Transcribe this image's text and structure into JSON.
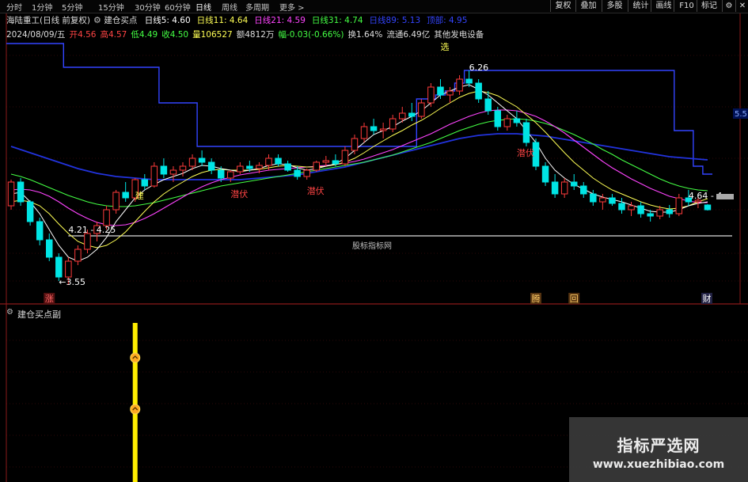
{
  "toolbar": {
    "periods": [
      "分时",
      "1分钟",
      "5分钟",
      "15分钟",
      "30分钟",
      "60分钟",
      "日线",
      "周线",
      "多周期",
      "更多 >"
    ],
    "active_period": "日线",
    "buttons": [
      "复权",
      "叠加",
      "多股",
      "统计",
      "画线",
      "F10",
      "标记"
    ]
  },
  "header": {
    "stock": "海陆重工(日线 前复权)",
    "indicator": "建仓买点",
    "ma": [
      {
        "label": "日线5:",
        "value": "4.60",
        "color": "#ffffff"
      },
      {
        "label": "日线11:",
        "value": "4.64",
        "color": "#ffff55"
      },
      {
        "label": "日线21:",
        "value": "4.59",
        "color": "#ff44ff"
      },
      {
        "label": "日线31:",
        "value": "4.74",
        "color": "#44ff44"
      },
      {
        "label": "日线89:",
        "value": "5.13",
        "color": "#3344ff"
      },
      {
        "label": "顶部:",
        "value": "4.95",
        "color": "#3344ff"
      }
    ],
    "date": "2024/08/09/五",
    "open_label": "开",
    "open": "4.56",
    "high_label": "高",
    "high": "4.57",
    "low_label": "低",
    "low": "4.49",
    "close_label": "收",
    "close": "4.50",
    "volume_label": "量",
    "volume": "106527",
    "amount_label": "额",
    "amount": "4812万",
    "change_label": "幅",
    "change": "-0.03(-0.66%)",
    "turnover_label": "换",
    "turnover": "1.64%",
    "float_label": "流通",
    "float": "6.49亿",
    "sector": "其他发电设备"
  },
  "indicator_panel": {
    "label": "建仓买点副"
  },
  "watermark": {
    "title": "指标严选网",
    "url": "www.xuezhibiao.com"
  },
  "colors": {
    "up": "#ff3b3b",
    "down": "#00e5e5",
    "ma5": "#ffffff",
    "ma11": "#ffff55",
    "ma21": "#ff44ff",
    "ma31": "#44ff44",
    "ma89": "#2233dd",
    "top": "#3344ff",
    "signal": "#ffee00"
  },
  "chart_data": {
    "type": "candlestick",
    "ylim": [
      3.4,
      6.6
    ],
    "y_side_label": "5.5",
    "candles": [
      [
        4.55,
        4.88,
        4.5,
        4.85
      ],
      [
        4.85,
        4.9,
        4.55,
        4.6
      ],
      [
        4.6,
        4.62,
        4.3,
        4.35
      ],
      [
        4.35,
        4.4,
        4.05,
        4.12
      ],
      [
        4.12,
        4.2,
        3.85,
        3.9
      ],
      [
        3.9,
        3.95,
        3.6,
        3.65
      ],
      [
        3.65,
        3.9,
        3.55,
        3.85
      ],
      [
        3.85,
        4.05,
        3.8,
        4.0
      ],
      [
        4.0,
        4.25,
        3.95,
        4.2
      ],
      [
        4.2,
        4.35,
        4.1,
        4.3
      ],
      [
        4.3,
        4.55,
        4.25,
        4.5
      ],
      [
        4.5,
        4.75,
        4.45,
        4.72
      ],
      [
        4.72,
        4.85,
        4.6,
        4.65
      ],
      [
        4.65,
        4.9,
        4.6,
        4.88
      ],
      [
        4.88,
        4.95,
        4.75,
        4.8
      ],
      [
        4.8,
        5.1,
        4.78,
        5.05
      ],
      [
        5.05,
        5.15,
        4.9,
        4.95
      ],
      [
        4.95,
        5.05,
        4.85,
        5.0
      ],
      [
        5.0,
        5.1,
        4.92,
        5.05
      ],
      [
        5.05,
        5.2,
        5.0,
        5.15
      ],
      [
        5.15,
        5.25,
        5.05,
        5.1
      ],
      [
        5.1,
        5.15,
        4.95,
        5.0
      ],
      [
        5.0,
        5.05,
        4.85,
        4.9
      ],
      [
        4.9,
        5.0,
        4.85,
        4.98
      ],
      [
        4.98,
        5.1,
        4.95,
        5.05
      ],
      [
        5.05,
        5.12,
        4.98,
        5.02
      ],
      [
        5.02,
        5.1,
        4.96,
        5.06
      ],
      [
        5.06,
        5.2,
        5.0,
        5.15
      ],
      [
        5.15,
        5.2,
        5.05,
        5.08
      ],
      [
        5.08,
        5.12,
        4.98,
        5.0
      ],
      [
        5.0,
        5.05,
        4.88,
        4.92
      ],
      [
        4.92,
        5.02,
        4.88,
        5.0
      ],
      [
        5.0,
        5.12,
        4.98,
        5.1
      ],
      [
        5.1,
        5.18,
        5.05,
        5.12
      ],
      [
        5.12,
        5.2,
        5.05,
        5.08
      ],
      [
        5.08,
        5.3,
        5.05,
        5.25
      ],
      [
        5.25,
        5.45,
        5.2,
        5.4
      ],
      [
        5.4,
        5.6,
        5.35,
        5.55
      ],
      [
        5.55,
        5.65,
        5.45,
        5.5
      ],
      [
        5.5,
        5.6,
        5.4,
        5.52
      ],
      [
        5.52,
        5.7,
        5.48,
        5.65
      ],
      [
        5.65,
        5.8,
        5.6,
        5.72
      ],
      [
        5.72,
        5.85,
        5.62,
        5.68
      ],
      [
        5.68,
        5.9,
        5.65,
        5.85
      ],
      [
        5.85,
        6.1,
        5.8,
        6.05
      ],
      [
        6.05,
        6.15,
        5.9,
        5.95
      ],
      [
        5.95,
        6.05,
        5.85,
        6.0
      ],
      [
        6.0,
        6.2,
        5.95,
        6.15
      ],
      [
        6.15,
        6.26,
        6.05,
        6.1
      ],
      [
        6.1,
        6.15,
        5.85,
        5.9
      ],
      [
        5.9,
        6.0,
        5.7,
        5.75
      ],
      [
        5.75,
        5.8,
        5.5,
        5.55
      ],
      [
        5.55,
        5.7,
        5.5,
        5.65
      ],
      [
        5.65,
        5.75,
        5.55,
        5.6
      ],
      [
        5.6,
        5.65,
        5.3,
        5.35
      ],
      [
        5.35,
        5.4,
        5.0,
        5.05
      ],
      [
        5.05,
        5.1,
        4.8,
        4.85
      ],
      [
        4.85,
        4.95,
        4.65,
        4.7
      ],
      [
        4.7,
        4.9,
        4.65,
        4.85
      ],
      [
        4.85,
        4.95,
        4.75,
        4.8
      ],
      [
        4.8,
        4.85,
        4.65,
        4.7
      ],
      [
        4.7,
        4.75,
        4.55,
        4.6
      ],
      [
        4.6,
        4.7,
        4.5,
        4.65
      ],
      [
        4.65,
        4.7,
        4.55,
        4.58
      ],
      [
        4.58,
        4.65,
        4.45,
        4.5
      ],
      [
        4.5,
        4.6,
        4.42,
        4.55
      ],
      [
        4.55,
        4.6,
        4.4,
        4.45
      ],
      [
        4.45,
        4.5,
        4.35,
        4.42
      ],
      [
        4.42,
        4.55,
        4.38,
        4.5
      ],
      [
        4.5,
        4.56,
        4.4,
        4.45
      ],
      [
        4.45,
        4.7,
        4.42,
        4.65
      ],
      [
        4.65,
        4.75,
        4.55,
        4.6
      ],
      [
        4.6,
        4.66,
        4.52,
        4.62
      ],
      [
        4.56,
        4.57,
        4.49,
        4.5
      ]
    ],
    "ma5": [
      4.7,
      4.72,
      4.6,
      4.45,
      4.25,
      4.05,
      3.9,
      3.85,
      3.9,
      4.0,
      4.15,
      4.35,
      4.5,
      4.65,
      4.75,
      4.82,
      4.88,
      4.92,
      4.96,
      5.02,
      5.06,
      5.05,
      5.02,
      5.0,
      4.98,
      5.0,
      5.02,
      5.06,
      5.08,
      5.07,
      5.03,
      5.0,
      5.02,
      5.05,
      5.08,
      5.15,
      5.25,
      5.35,
      5.45,
      5.5,
      5.55,
      5.62,
      5.68,
      5.75,
      5.85,
      5.95,
      6.0,
      6.05,
      6.08,
      6.02,
      5.95,
      5.85,
      5.75,
      5.65,
      5.5,
      5.35,
      5.15,
      5.0,
      4.9,
      4.82,
      4.76,
      4.7,
      4.66,
      4.63,
      4.6,
      4.56,
      4.52,
      4.48,
      4.47,
      4.47,
      4.5,
      4.55,
      4.58,
      4.6
    ],
    "ma11": [
      4.6,
      4.62,
      4.6,
      4.55,
      4.45,
      4.32,
      4.2,
      4.1,
      4.05,
      4.02,
      4.05,
      4.12,
      4.22,
      4.35,
      4.48,
      4.6,
      4.7,
      4.78,
      4.85,
      4.92,
      4.97,
      5.0,
      5.01,
      5.0,
      5.0,
      5.0,
      5.01,
      5.03,
      5.05,
      5.06,
      5.05,
      5.04,
      5.04,
      5.05,
      5.07,
      5.1,
      5.15,
      5.22,
      5.3,
      5.37,
      5.44,
      5.5,
      5.57,
      5.63,
      5.7,
      5.78,
      5.85,
      5.92,
      5.97,
      6.0,
      5.98,
      5.94,
      5.87,
      5.8,
      5.7,
      5.6,
      5.48,
      5.35,
      5.22,
      5.1,
      5.0,
      4.9,
      4.82,
      4.75,
      4.7,
      4.65,
      4.6,
      4.56,
      4.53,
      4.51,
      4.52,
      4.55,
      4.6,
      4.64
    ],
    "ma21": [
      4.75,
      4.76,
      4.75,
      4.72,
      4.67,
      4.6,
      4.52,
      4.45,
      4.39,
      4.34,
      4.31,
      4.3,
      4.31,
      4.34,
      4.39,
      4.45,
      4.52,
      4.59,
      4.66,
      4.73,
      4.79,
      4.84,
      4.88,
      4.91,
      4.94,
      4.96,
      4.98,
      5.0,
      5.01,
      5.02,
      5.03,
      5.04,
      5.05,
      5.06,
      5.07,
      5.09,
      5.11,
      5.14,
      5.18,
      5.22,
      5.26,
      5.31,
      5.36,
      5.41,
      5.46,
      5.52,
      5.58,
      5.63,
      5.68,
      5.72,
      5.75,
      5.76,
      5.76,
      5.75,
      5.72,
      5.68,
      5.62,
      5.55,
      5.47,
      5.38,
      5.29,
      5.2,
      5.11,
      5.03,
      4.96,
      4.89,
      4.83,
      4.77,
      4.72,
      4.67,
      4.64,
      4.61,
      4.59,
      4.59
    ],
    "ma31": [
      4.95,
      4.92,
      4.88,
      4.83,
      4.78,
      4.73,
      4.68,
      4.64,
      4.6,
      4.57,
      4.55,
      4.54,
      4.54,
      4.55,
      4.57,
      4.59,
      4.62,
      4.65,
      4.68,
      4.71,
      4.74,
      4.77,
      4.8,
      4.82,
      4.84,
      4.86,
      4.88,
      4.9,
      4.92,
      4.94,
      4.96,
      4.98,
      5.0,
      5.02,
      5.04,
      5.06,
      5.08,
      5.1,
      5.13,
      5.16,
      5.19,
      5.23,
      5.27,
      5.31,
      5.35,
      5.4,
      5.45,
      5.5,
      5.54,
      5.58,
      5.61,
      5.63,
      5.64,
      5.65,
      5.64,
      5.62,
      5.59,
      5.55,
      5.5,
      5.45,
      5.39,
      5.33,
      5.26,
      5.2,
      5.13,
      5.07,
      5.01,
      4.95,
      4.89,
      4.84,
      4.8,
      4.77,
      4.75,
      4.74
    ],
    "ma89": [
      5.3,
      5.26,
      5.22,
      5.18,
      5.14,
      5.1,
      5.06,
      5.02,
      4.99,
      4.96,
      4.94,
      4.92,
      4.91,
      4.9,
      4.89,
      4.88,
      4.88,
      4.88,
      4.88,
      4.88,
      4.88,
      4.88,
      4.88,
      4.88,
      4.88,
      4.89,
      4.9,
      4.91,
      4.92,
      4.93,
      4.94,
      4.96,
      4.98,
      5.0,
      5.02,
      5.04,
      5.07,
      5.1,
      5.13,
      5.16,
      5.19,
      5.22,
      5.25,
      5.28,
      5.31,
      5.34,
      5.37,
      5.4,
      5.42,
      5.44,
      5.45,
      5.46,
      5.46,
      5.46,
      5.45,
      5.44,
      5.43,
      5.41,
      5.39,
      5.37,
      5.35,
      5.33,
      5.31,
      5.29,
      5.27,
      5.25,
      5.23,
      5.21,
      5.19,
      5.17,
      5.16,
      5.15,
      5.14,
      5.13
    ],
    "top": [
      6.6,
      6.6,
      6.6,
      6.6,
      6.6,
      6.6,
      6.3,
      6.3,
      6.3,
      6.3,
      6.3,
      6.3,
      6.3,
      6.3,
      6.3,
      6.3,
      5.85,
      5.85,
      5.85,
      5.85,
      5.3,
      5.3,
      5.3,
      5.3,
      5.3,
      5.3,
      5.3,
      5.3,
      5.3,
      5.3,
      5.3,
      5.3,
      5.3,
      5.3,
      5.3,
      5.3,
      5.3,
      5.3,
      5.3,
      5.3,
      5.3,
      5.3,
      5.3,
      5.9,
      5.9,
      5.95,
      6.0,
      6.1,
      6.26,
      6.26,
      6.26,
      6.26,
      6.26,
      6.26,
      6.26,
      6.26,
      6.26,
      6.26,
      6.26,
      6.26,
      6.26,
      6.26,
      6.26,
      6.26,
      6.26,
      6.26,
      6.26,
      6.26,
      6.26,
      6.26,
      5.5,
      5.5,
      5.05,
      4.95
    ],
    "support_level": 4.21,
    "annotations": [
      {
        "text": "6.26",
        "i": 48,
        "y": 6.26,
        "color": "#ffffff"
      },
      {
        "text": "←3.55",
        "i": 5,
        "y": 3.55,
        "color": "#ffffff"
      },
      {
        "text": "4.21 - 4.25",
        "i": 6,
        "y": 4.21,
        "color": "#ffffff"
      },
      {
        "text": "4.64 - 4",
        "i": 71,
        "y": 4.64,
        "color": "#ffffff"
      },
      {
        "text": "选",
        "i": 45,
        "y": 6.52,
        "color": "#ffff55"
      },
      {
        "text": "建",
        "i": 13,
        "y": 4.64,
        "color": "#ffff55"
      },
      {
        "text": "潜伏",
        "i": 23,
        "y": 4.66,
        "color": "#ff4444"
      },
      {
        "text": "潜伏",
        "i": 31,
        "y": 4.7,
        "color": "#ff4444"
      },
      {
        "text": "潜伏",
        "i": 53,
        "y": 5.18,
        "color": "#ff4444"
      }
    ],
    "center_label": "股标指标网",
    "markers": [
      {
        "text": "涨",
        "i": 4,
        "color": "#ff6666",
        "bg": "#551111"
      },
      {
        "text": "腾",
        "i": 55,
        "color": "#ffcc66",
        "bg": "#553311"
      },
      {
        "text": "回",
        "i": 59,
        "color": "#ffcc66",
        "bg": "#553311"
      },
      {
        "text": "财",
        "i": 79,
        "color": "#ffffff",
        "bg": "#222244"
      }
    ],
    "signal_bar": {
      "i": 13,
      "arrows": 2
    }
  }
}
